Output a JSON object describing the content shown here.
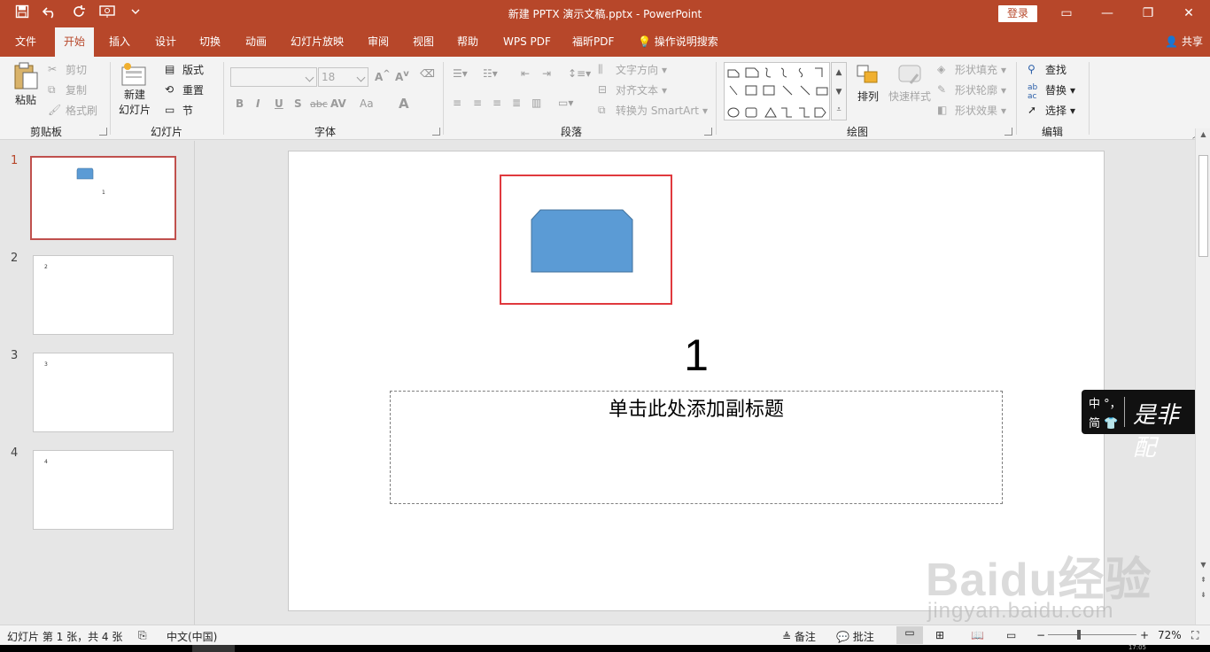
{
  "window": {
    "title": "新建 PPTX 演示文稿.pptx  -  PowerPoint",
    "login": "登录",
    "controls": [
      "▭",
      "—",
      "❐",
      "✕"
    ]
  },
  "qat": {
    "icons": [
      "save-icon",
      "undo-icon",
      "redo-icon",
      "presentation-icon",
      "customize-icon"
    ]
  },
  "tabs": [
    "文件",
    "开始",
    "插入",
    "设计",
    "切换",
    "动画",
    "幻灯片放映",
    "审阅",
    "视图",
    "帮助",
    "WPS PDF",
    "福昕PDF",
    "操作说明搜索"
  ],
  "active_tab": "开始",
  "share": "共享",
  "ribbon": {
    "clipboard": {
      "paste": "粘贴",
      "cut": "剪切",
      "copy": "复制",
      "format_painter": "格式刷",
      "label": "剪贴板"
    },
    "slides": {
      "new_slide_1": "新建",
      "new_slide_2": "幻灯片",
      "layout": "版式",
      "reset": "重置",
      "section": "节",
      "label": "幻灯片"
    },
    "font": {
      "size": "18",
      "label": "字体",
      "buttons": [
        "B",
        "I",
        "U",
        "S",
        "abc",
        "AV",
        "Aa",
        "A"
      ]
    },
    "paragraph": {
      "text_direction": "文字方向",
      "align_text": "对齐文本",
      "smartart": "转换为 SmartArt",
      "label": "段落"
    },
    "drawing": {
      "arrange": "排列",
      "quick_styles": "快速样式",
      "shape_fill": "形状填充",
      "shape_outline": "形状轮廓",
      "shape_effects": "形状效果",
      "label": "绘图"
    },
    "editing": {
      "find": "查找",
      "replace": "替换",
      "select": "选择",
      "label": "编辑"
    }
  },
  "thumbnails": [
    {
      "num": "1",
      "text": "1"
    },
    {
      "num": "2",
      "text": "2"
    },
    {
      "num": "3",
      "text": "3"
    },
    {
      "num": "4",
      "text": "4"
    }
  ],
  "slide": {
    "title": "1",
    "subtitle_placeholder": "单击此处添加副标题",
    "shape_color": "#5b9bd5"
  },
  "badge": {
    "line1": "中 °，",
    "line2": "简 👕",
    "script": "是非配"
  },
  "watermark": {
    "logo": "Baidu经验",
    "url": "jingyan.baidu.com"
  },
  "status": {
    "slide_info": "幻灯片 第 1 张，共 4 张",
    "language": "中文(中国)",
    "notes": "备注",
    "comments": "批注",
    "zoom": "72%",
    "minus": "−",
    "plus": "+",
    "clock": "17:05"
  },
  "colors": {
    "accent": "#b7472a",
    "selection": "#e0393e"
  }
}
